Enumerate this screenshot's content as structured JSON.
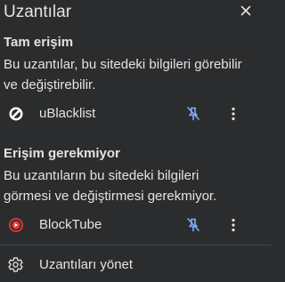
{
  "popup": {
    "title": "Uzantılar"
  },
  "sections": [
    {
      "title": "Tam erişim",
      "description_line1": "Bu uzantılar, bu sitedeki bilgileri görebilir",
      "description_line2": "ve değiştirebilir.",
      "extension": {
        "name": "uBlacklist",
        "icon": "ublacklist-icon"
      }
    },
    {
      "title": "Erişim gerekmiyor",
      "description_line1": "Bu uzantıların bu sitedeki bilgileri",
      "description_line2": "görmesi ve değiştirmesi gerekmiyor.",
      "extension": {
        "name": "BlockTube",
        "icon": "blocktube-icon"
      }
    }
  ],
  "footer": {
    "manage_label": "Uzantıları yönet"
  },
  "colors": {
    "background": "#2b2c2e",
    "text": "#e3e3e3",
    "pin_accent": "#7cacf8",
    "divider": "#474747",
    "blocktube_red": "#e53935"
  }
}
